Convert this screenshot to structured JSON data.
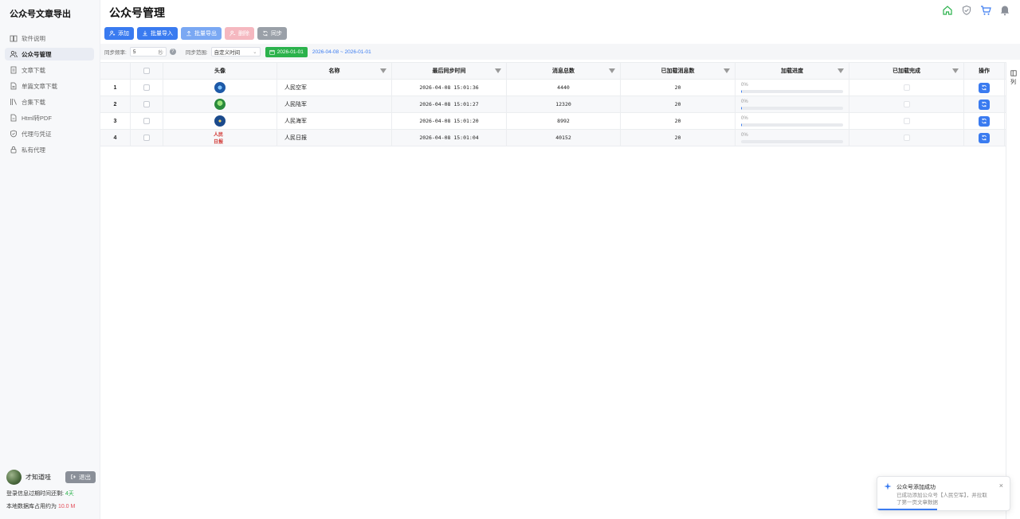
{
  "app": {
    "title": "公众号文章导出"
  },
  "sidebar": {
    "items": [
      {
        "label": "软件说明",
        "icon": "book-icon",
        "active": false
      },
      {
        "label": "公众号管理",
        "icon": "users-icon",
        "active": true
      },
      {
        "label": "文章下载",
        "icon": "document-icon",
        "active": false
      },
      {
        "label": "单篇文章下载",
        "icon": "file-icon",
        "active": false
      },
      {
        "label": "合集下载",
        "icon": "library-icon",
        "active": false
      },
      {
        "label": "Html转PDF",
        "icon": "pdf-icon",
        "active": false
      },
      {
        "label": "代理与凭证",
        "icon": "shield-icon",
        "active": false
      },
      {
        "label": "私有代理",
        "icon": "lock-icon",
        "active": false
      }
    ],
    "user": {
      "name": "才知道哇",
      "logout_label": "退出"
    },
    "login_info_prefix": "登录信息过期时间还剩:",
    "login_info_value": "4天",
    "db_info_prefix": "本地数据库占用约为",
    "db_info_value": "10.0 M"
  },
  "header": {
    "title": "公众号管理",
    "icons": [
      "home-icon",
      "shield-check-icon",
      "cart-icon",
      "bell-icon"
    ]
  },
  "toolbar": {
    "add": "添加",
    "batch_import": "批量导入",
    "batch_export": "批量导出",
    "delete": "删除",
    "sync": "同步"
  },
  "syncbar": {
    "freq_label": "同步频率:",
    "freq_value": "5",
    "freq_unit": "秒",
    "range_label": "同步范围:",
    "range_value": "自定义时间",
    "date_button": "2026-01-01",
    "date_range": "2026-04-08 ~ 2026-01-01"
  },
  "table": {
    "headers": {
      "avatar": "头像",
      "name": "名称",
      "last_sync": "最后同步时间",
      "total": "消息总数",
      "loaded": "已加载消息数",
      "progress": "加载进度",
      "done": "已加载完成",
      "ops": "操作"
    },
    "rows": [
      {
        "index": "1",
        "logo": "air",
        "name": "人民空军",
        "last_sync": "2026-04-08 15:01:36",
        "total": "4440",
        "loaded": "20",
        "progress_label": "0%",
        "progress": 0.004
      },
      {
        "index": "2",
        "logo": "army",
        "name": "人民陆军",
        "last_sync": "2026-04-08 15:01:27",
        "total": "12320",
        "loaded": "20",
        "progress_label": "0%",
        "progress": 0.002
      },
      {
        "index": "3",
        "logo": "navy",
        "name": "人民海军",
        "last_sync": "2026-04-08 15:01:20",
        "total": "8992",
        "loaded": "20",
        "progress_label": "0%",
        "progress": 0.002
      },
      {
        "index": "4",
        "logo": "daily",
        "logo_text": "人民日报",
        "name": "人民日报",
        "last_sync": "2026-04-08 15:01:04",
        "total": "40152",
        "loaded": "20",
        "progress_label": "0%",
        "progress": 0.0005
      }
    ]
  },
  "column_settings": {
    "label": "列"
  },
  "toast": {
    "title": "公众号添加成功",
    "message": "已成功添加公众号【人民空军】，并拉取了第一页文章数据",
    "close": "×",
    "progress": 0.45
  },
  "colors": {
    "primary": "#3a7bf0",
    "success": "#2bb24c",
    "danger": "#e34d59"
  }
}
